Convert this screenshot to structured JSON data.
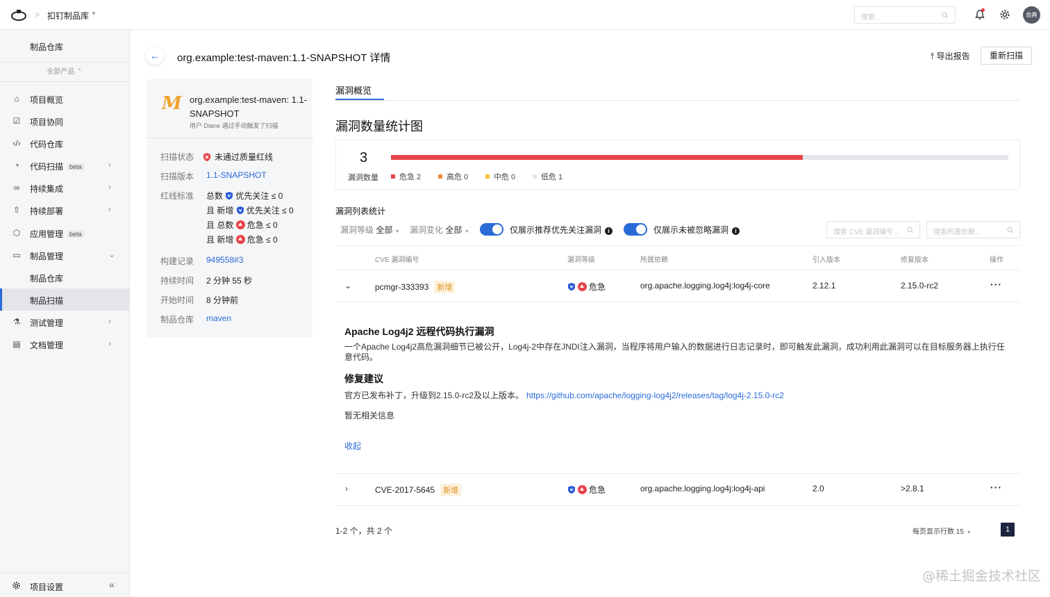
{
  "topbar": {
    "title": "扣钉制品库",
    "search_placeholder": "搜索...",
    "avatar_text": "俞典"
  },
  "sidebar": {
    "top": "制品仓库",
    "all_products": "全部产品 ⌃",
    "items": [
      {
        "label": "项目概览",
        "icon": "home-icon"
      },
      {
        "label": "项目协同",
        "icon": "checkbox-icon"
      },
      {
        "label": "代码仓库",
        "icon": "code-icon"
      },
      {
        "label": "代码扫描",
        "icon": "scan-icon",
        "badge": "beta"
      },
      {
        "label": "持续集成",
        "icon": "infinity-icon"
      },
      {
        "label": "持续部署",
        "icon": "rocket-icon"
      },
      {
        "label": "应用管理",
        "icon": "hexagon-icon",
        "badge": "beta"
      },
      {
        "label": "制品管理",
        "icon": "box-icon"
      },
      {
        "label": "制品仓库"
      },
      {
        "label": "制品扫描"
      },
      {
        "label": "测试管理",
        "icon": "flask-icon"
      },
      {
        "label": "文档管理",
        "icon": "doc-icon"
      }
    ],
    "footer": "项目设置"
  },
  "header": {
    "title": "org.example:test-maven:1.1-SNAPSHOT 详情",
    "export": "导出报告",
    "rescan": "重新扫描"
  },
  "info": {
    "logo": "M",
    "name": "org.example:test-maven: 1.1-SNAPSHOT",
    "sub": "用户 Diane 通过手动触发了扫描",
    "scan_status_k": "扫描状态",
    "scan_status_v": "未通过质量红线",
    "scan_version_k": "扫描版本",
    "scan_version_v": "1.1-SNAPSHOT",
    "redline_k": "红线标准",
    "redline": [
      {
        "prefix": "总数",
        "kind": "shield",
        "label": "优先关注 ≤ 0"
      },
      {
        "prefix": "且 新增",
        "kind": "shield",
        "label": "优先关注 ≤ 0"
      },
      {
        "prefix": "且 总数",
        "kind": "critical",
        "label": "危急 ≤ 0"
      },
      {
        "prefix": "且 新增",
        "kind": "critical",
        "label": "危急 ≤ 0"
      }
    ],
    "build_k": "构建记录",
    "build_v": "949558#3",
    "duration_k": "持续时间",
    "duration_v": "2 分钟 55 秒",
    "start_k": "开始时间",
    "start_v": "8 分钟前",
    "repo_k": "制品仓库",
    "repo_v": "maven"
  },
  "main": {
    "tab": "漏洞概览",
    "stats_title": "漏洞数量统计图",
    "total": "3",
    "total_label": "漏洞数量",
    "critical_fraction": 0.667,
    "legend": [
      {
        "label": "危急 2",
        "color": "#e8454a"
      },
      {
        "label": "高危 0",
        "color": "#f08a3c"
      },
      {
        "label": "中危 0",
        "color": "#f5c038"
      },
      {
        "label": "低危 1",
        "color": "#e3e5e9"
      }
    ],
    "list_title": "漏洞列表统计",
    "filter_level": "漏洞等级",
    "filter_level_v": "全部",
    "filter_change": "漏洞变化",
    "filter_change_v": "全部",
    "toggle1": "仅展示推荐优先关注漏洞",
    "toggle2": "仅展示未被忽略漏洞",
    "search1": "搜索 CVE 漏洞编号...",
    "search2": "搜索所属依赖...",
    "columns": [
      "CVE 漏洞编号",
      "漏洞等级",
      "所属依赖",
      "引入版本",
      "修复版本",
      "操作"
    ],
    "rows": [
      {
        "id": "pcmgr-333393",
        "tag": "新增",
        "level": "危急",
        "dep": "org.apache.logging.log4j:log4j-core",
        "intro": "2.12.1",
        "fix": "2.15.0-rc2"
      },
      {
        "id": "CVE-2017-5645",
        "tag": "新增",
        "level": "危急",
        "dep": "org.apache.logging.log4j:log4j-api",
        "intro": "2.0",
        "fix": ">2.8.1"
      }
    ],
    "detail": {
      "title": "Apache Log4j2 远程代码执行漏洞",
      "text": "一个Apache Log4j2高危漏洞细节已被公开，Log4j-2中存在JNDI注入漏洞，当程序将用户输入的数据进行日志记录时，即可触发此漏洞，成功利用此漏洞可以在目标服务器上执行任意代码。",
      "fix_title": "修复建议",
      "fix_text": "官方已发布补丁，升级到2.15.0-rc2及以上版本。",
      "fix_link": "https://github.com/apache/logging-log4j2/releases/tag/log4j-2.15.0-rc2",
      "no_info": "暂无相关信息",
      "collapse": "收起"
    },
    "pager_summary": "1-2 个，共 2 个",
    "page_size": "每页显示行数 15",
    "page": "1"
  },
  "watermark": "@稀土掘金技术社区"
}
